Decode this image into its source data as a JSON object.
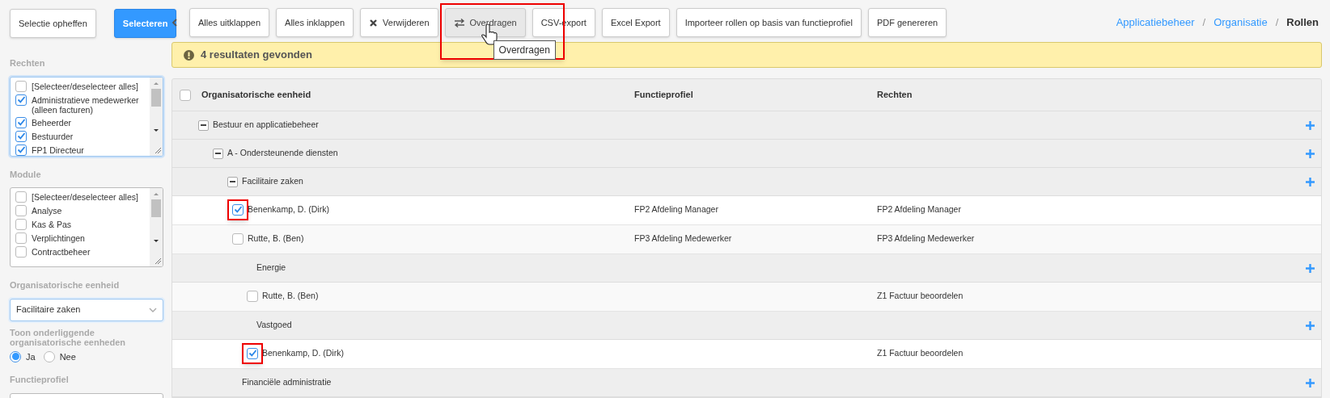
{
  "toolbar": {
    "buttons": [
      {
        "label": "Selectie opheffen",
        "kind": "plain",
        "hovered": false,
        "highlighted": false
      },
      {
        "label": "Selecteren",
        "kind": "primary",
        "hovered": false,
        "highlighted": false
      },
      {
        "label": "Alles uitklappen",
        "kind": "plain",
        "hovered": false,
        "highlighted": false
      },
      {
        "label": "Alles inklappen",
        "kind": "plain",
        "hovered": false,
        "highlighted": false
      },
      {
        "label": "Verwijderen",
        "kind": "delete",
        "hovered": false,
        "highlighted": false
      },
      {
        "label": "Overdragen",
        "kind": "transfer",
        "hovered": true,
        "highlighted": true
      },
      {
        "label": "CSV-export",
        "kind": "plain",
        "hovered": false,
        "highlighted": false
      },
      {
        "label": "Excel Export",
        "kind": "plain",
        "hovered": false,
        "highlighted": false
      },
      {
        "label": "Importeer rollen op basis van functieprofiel",
        "kind": "plain",
        "hovered": false,
        "highlighted": false
      },
      {
        "label": "PDF genereren",
        "kind": "plain",
        "hovered": false,
        "highlighted": false
      }
    ],
    "tooltip": "Overdragen"
  },
  "breadcrumb": [
    {
      "kind": "link",
      "label": "Applicatiebeheer",
      "current": false
    },
    {
      "kind": "separator",
      "label": "/"
    },
    {
      "kind": "link",
      "label": "Organisatie",
      "current": false
    },
    {
      "kind": "separator",
      "label": "/"
    },
    {
      "kind": "link",
      "label": "Rollen",
      "current": true
    }
  ],
  "sidebar": {
    "rechten": {
      "label": "Rechten",
      "focused": true,
      "options": [
        {
          "label": "[Selecteer/deselecteer alles]",
          "checked": false
        },
        {
          "label": "Administratieve medewerker (alleen facturen)",
          "checked": true
        },
        {
          "label": "Beheerder",
          "checked": true
        },
        {
          "label": "Bestuurder",
          "checked": true
        },
        {
          "label": "FP1 Directeur",
          "checked": true
        }
      ]
    },
    "module": {
      "label": "Module",
      "focused": false,
      "options": [
        {
          "label": "[Selecteer/deselecteer alles]",
          "checked": false
        },
        {
          "label": "Analyse",
          "checked": false
        },
        {
          "label": "Kas & Pas",
          "checked": false
        },
        {
          "label": "Verplichtingen",
          "checked": false
        },
        {
          "label": "Contractbeheer",
          "checked": false
        }
      ]
    },
    "org_unit": {
      "label": "Organisatorische eenheid",
      "value": "Facilitaire zaken"
    },
    "show_sub_units": {
      "label": "Toon onderliggende organisatorische eenheden",
      "options": [
        {
          "label": "Ja",
          "selected": true
        },
        {
          "label": "Nee",
          "selected": false
        }
      ]
    },
    "functieprofiel": {
      "label": "Functieprofiel"
    }
  },
  "alert": {
    "text": "4 resultaten gevonden"
  },
  "table": {
    "columns": [
      "Organisatorische eenheid",
      "Functieprofiel",
      "Rechten"
    ],
    "all_checked": false,
    "rows": [
      {
        "kind": "group",
        "label": "Bestuur en applicatiebeheer",
        "expanded": true,
        "children": [
          {
            "kind": "group",
            "label": "A - Ondersteunende diensten",
            "expanded": true,
            "children": [
              {
                "kind": "group",
                "label": "Facilitaire zaken",
                "expanded": true,
                "children": [
                  {
                    "kind": "person",
                    "label": "Benenkamp, D. (Dirk)",
                    "functieprofiel": "FP2 Afdeling Manager",
                    "rechten": "FP2 Afdeling Manager",
                    "checked": true,
                    "highlighted": true
                  },
                  {
                    "kind": "person",
                    "label": "Rutte, B. (Ben)",
                    "functieprofiel": "FP3 Afdeling Medewerker",
                    "rechten": "FP3 Afdeling Medewerker",
                    "checked": false,
                    "highlighted": false
                  },
                  {
                    "kind": "subgroup",
                    "label": "Energie",
                    "children": [
                      {
                        "kind": "person",
                        "label": "Rutte, B. (Ben)",
                        "rechten": "Z1 Factuur beoordelen",
                        "checked": false,
                        "highlighted": false
                      }
                    ]
                  },
                  {
                    "kind": "subgroup",
                    "label": "Vastgoed",
                    "children": [
                      {
                        "kind": "person",
                        "label": "Benenkamp, D. (Dirk)",
                        "rechten": "Z1 Factuur beoordelen",
                        "checked": true,
                        "highlighted": true
                      }
                    ]
                  }
                ]
              },
              {
                "kind": "subgroup",
                "label": "Financiële administratie"
              }
            ]
          }
        ]
      }
    ]
  }
}
